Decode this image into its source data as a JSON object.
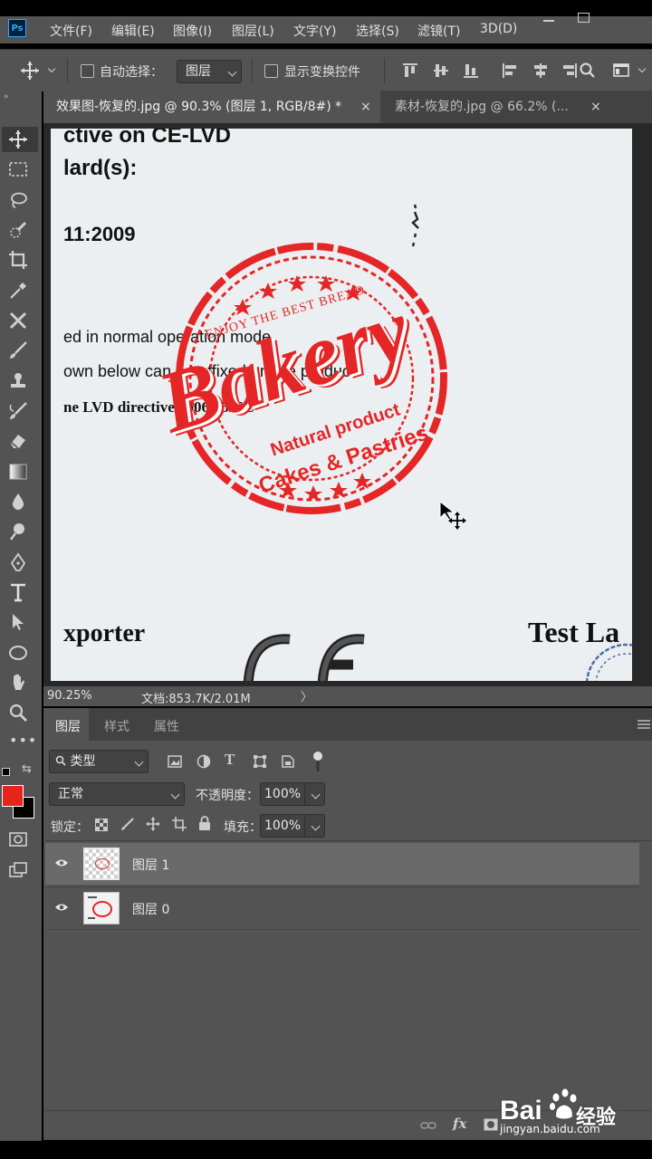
{
  "app": {
    "logo": "Ps"
  },
  "menu": [
    "文件(F)",
    "编辑(E)",
    "图像(I)",
    "图层(L)",
    "文字(Y)",
    "选择(S)",
    "滤镜(T)",
    "3D(D)"
  ],
  "options": {
    "auto_select_label": "自动选择：",
    "auto_select_value": "图层",
    "transform_label": "显示变换控件"
  },
  "tabs": [
    {
      "title": "效果图-恢复的.jpg @ 90.3% (图层 1, RGB/8#) *",
      "close": "×"
    },
    {
      "title": "素材-恢复的.jpg @ 66.2% (...",
      "close": "×"
    }
  ],
  "document": {
    "lines": [
      "ctive on CE-LVD",
      "lard(s):",
      "11:2009",
      "ed in normal operation mode.",
      "own below can be affixed on the product",
      "ne LVD directive 2006/95/EC",
      "xporter",
      "Test La"
    ],
    "stamp": {
      "top_text": "ENJOY THE BEST BREAD",
      "title": "Bakery",
      "line1": "Natural product",
      "line2": "Cakes & Pastries",
      "color": "#e42626"
    }
  },
  "status": {
    "zoom": "90.25%",
    "doc": "文档:853.7K/2.01M"
  },
  "panel": {
    "tabs": [
      "图层",
      "样式",
      "属性"
    ],
    "filter_label": "类型",
    "blend_mode": "正常",
    "opacity_label": "不透明度：",
    "opacity": "100%",
    "lock_label": "锁定：",
    "fill_label": "填充：",
    "fill": "100%",
    "layers": [
      {
        "name": "图层 1",
        "selected": true
      },
      {
        "name": "图层 0",
        "selected": false
      }
    ]
  },
  "colors": {
    "foreground": "#e8231a",
    "background": "#000000"
  },
  "watermark": {
    "brand": "Bai",
    "brand2": "经验",
    "url": "jingyan.baidu.com"
  }
}
